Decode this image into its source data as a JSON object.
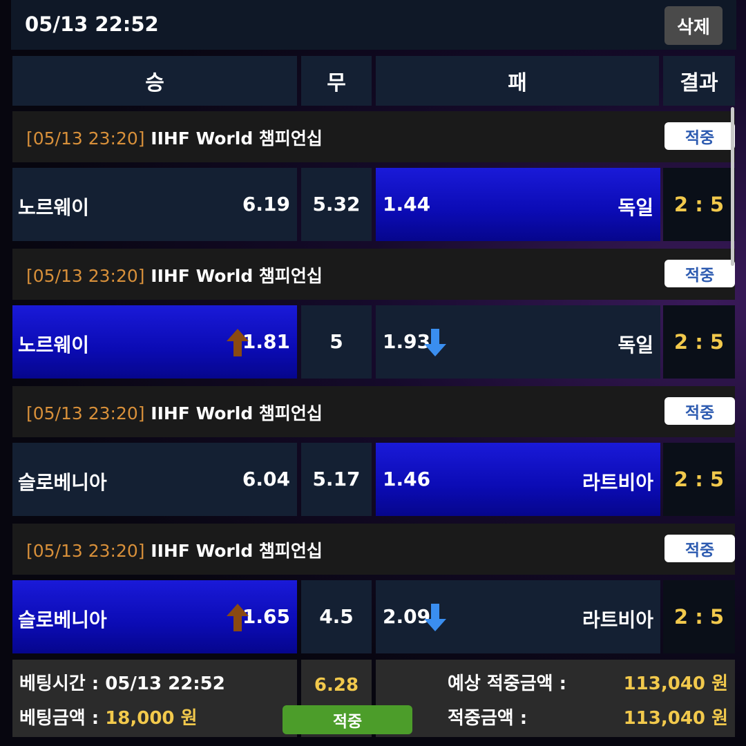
{
  "header": {
    "datetime": "05/13 22:52",
    "delete_label": "삭제"
  },
  "columns": {
    "win": "승",
    "draw": "무",
    "lose": "패",
    "result": "결과"
  },
  "matches": [
    {
      "date": "[05/13 23:20]",
      "league": "IIHF World 챔피언십",
      "status": "적중",
      "home": "노르웨이",
      "home_odds": "6.19",
      "draw_odds": "5.32",
      "away_odds": "1.44",
      "away": "독일",
      "score": "2 : 5",
      "selected": "away",
      "home_trend": "",
      "away_trend": ""
    },
    {
      "date": "[05/13 23:20]",
      "league": "IIHF World 챔피언십",
      "status": "적중",
      "home": "노르웨이",
      "home_odds": "1.81",
      "draw_odds": "5",
      "away_odds": "1.93",
      "away": "독일",
      "score": "2 : 5",
      "selected": "home",
      "home_trend": "up",
      "away_trend": "down"
    },
    {
      "date": "[05/13 23:20]",
      "league": "IIHF World 챔피언십",
      "status": "적중",
      "home": "슬로베니아",
      "home_odds": "6.04",
      "draw_odds": "5.17",
      "away_odds": "1.46",
      "away": "라트비아",
      "score": "2 : 5",
      "selected": "away",
      "home_trend": "",
      "away_trend": ""
    },
    {
      "date": "[05/13 23:20]",
      "league": "IIHF World 챔피언십",
      "status": "적중",
      "home": "슬로베니아",
      "home_odds": "1.65",
      "draw_odds": "4.5",
      "away_odds": "2.09",
      "away": "라트비아",
      "score": "2 : 5",
      "selected": "home",
      "home_trend": "up",
      "away_trend": "down"
    }
  ],
  "summary": {
    "bet_time_label": "베팅시간 : ",
    "bet_time": "05/13 22:52",
    "bet_amount_label": "베팅금액 : ",
    "bet_amount": "18,000 원",
    "total_odds": "6.28",
    "status_button": "적중",
    "expected_label": "예상 적중금액 :",
    "expected_amount": "113,040 원",
    "won_label": "적중금액 :",
    "won_amount": "113,040 원"
  },
  "colors": {
    "selected_bg": "#0b0bb4",
    "odds_up": "#8a4a12",
    "odds_down": "#3a8ef0",
    "score": "#f2c94c",
    "league_date": "#d8903a",
    "win_button": "#4c9d2a"
  },
  "icons": {
    "up": "arrow-up-icon",
    "down": "arrow-down-icon"
  }
}
